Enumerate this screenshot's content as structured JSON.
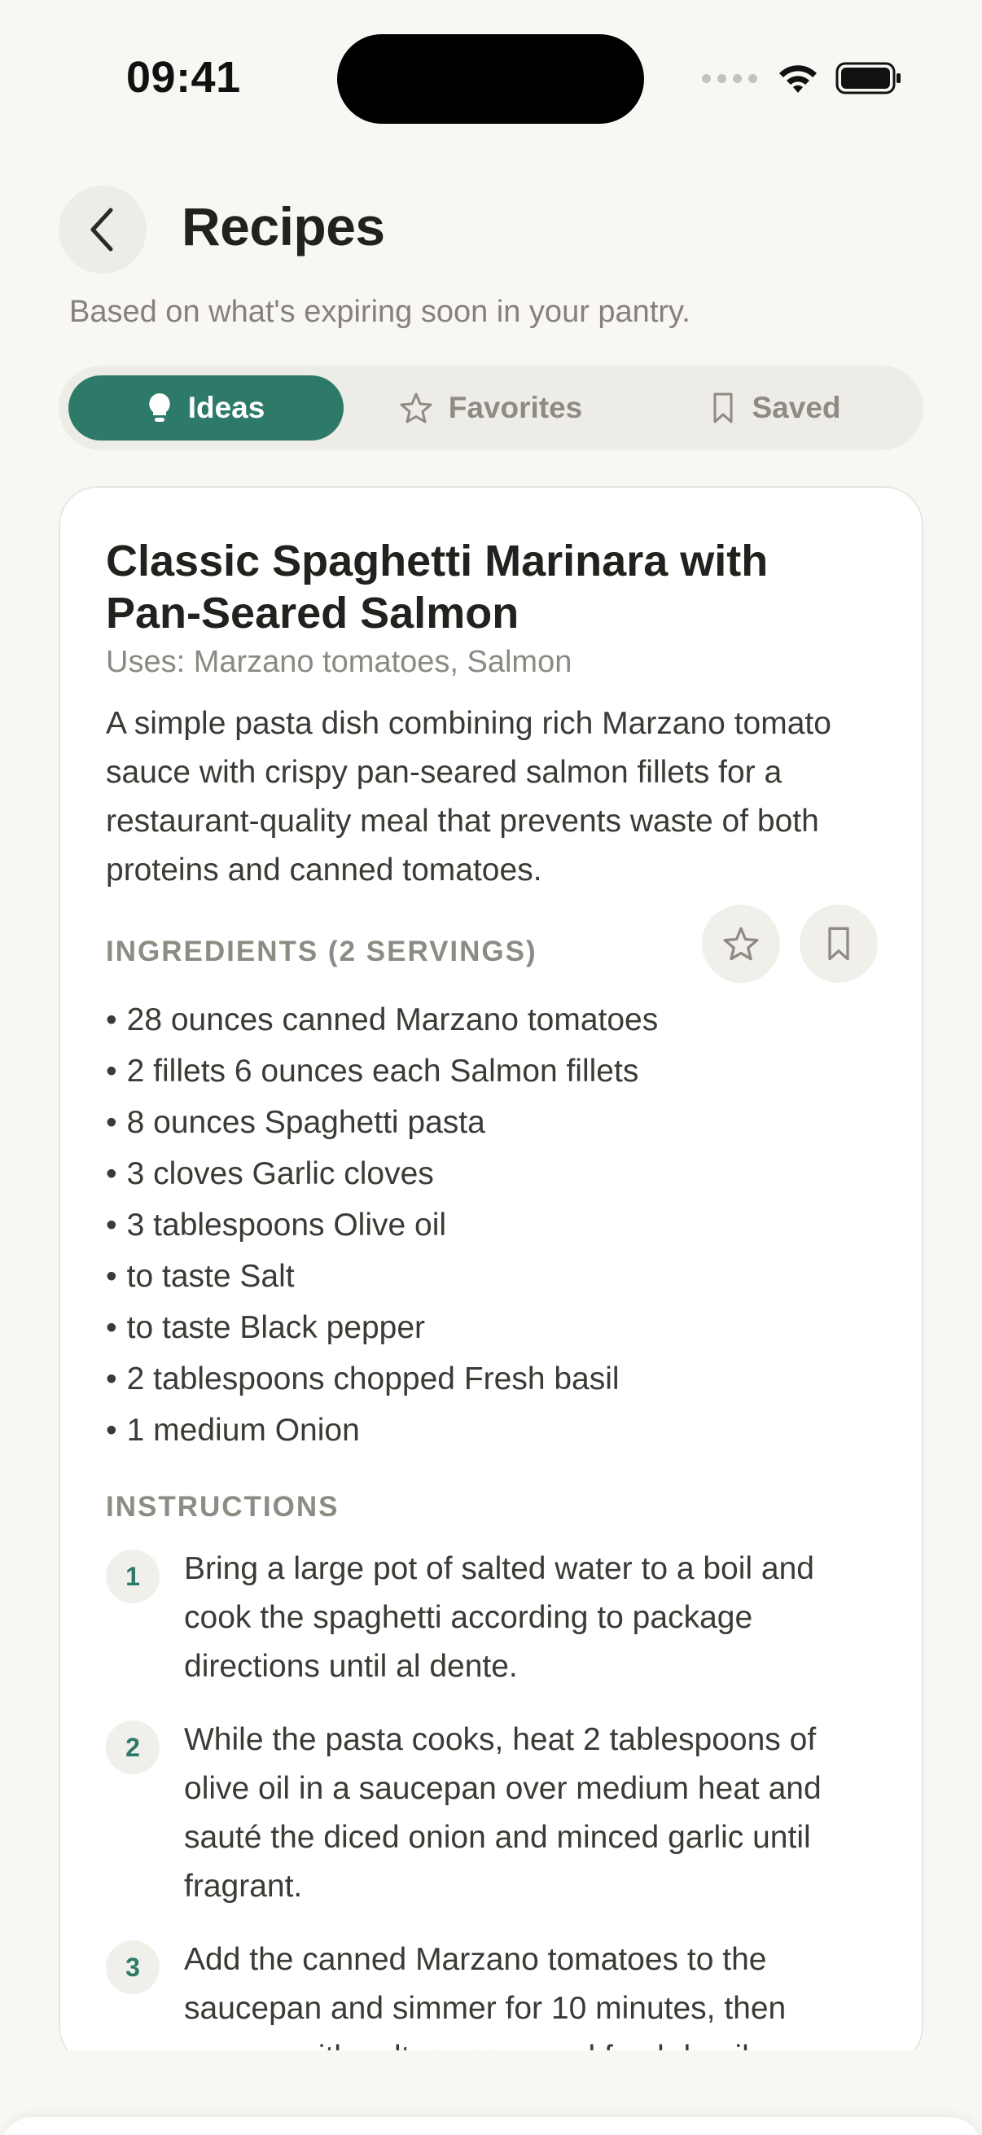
{
  "status_bar": {
    "time": "09:41"
  },
  "header": {
    "title": "Recipes",
    "subtitle": "Based on what's expiring soon in your pantry."
  },
  "tabs": [
    {
      "label": "Ideas",
      "icon": "lightbulb-icon",
      "active": true
    },
    {
      "label": "Favorites",
      "icon": "star-icon",
      "active": false
    },
    {
      "label": "Saved",
      "icon": "bookmark-icon",
      "active": false
    }
  ],
  "recipe": {
    "title": "Classic Spaghetti Marinara with Pan-Seared Salmon",
    "uses": "Uses: Marzano tomatoes, Salmon",
    "description": "A simple pasta dish combining rich Marzano tomato sauce with crispy pan-seared salmon fillets for a restaurant-quality meal that prevents waste of both proteins and canned tomatoes.",
    "ingredients_heading": "INGREDIENTS (2 SERVINGS)",
    "ingredients": [
      "28 ounces canned Marzano tomatoes",
      "2 fillets 6 ounces each Salmon fillets",
      "8 ounces Spaghetti pasta",
      "3 cloves Garlic cloves",
      "3 tablespoons Olive oil",
      "to taste Salt",
      "to taste Black pepper",
      "2 tablespoons chopped Fresh basil",
      "1 medium Onion"
    ],
    "instructions_heading": "INSTRUCTIONS",
    "instructions": [
      {
        "number": "1",
        "text": "Bring a large pot of salted water to a boil and cook the spaghetti according to package directions until al dente."
      },
      {
        "number": "2",
        "text": "While the pasta cooks, heat 2 tablespoons of olive oil in a saucepan over medium heat and sauté the diced onion and minced garlic until fragrant."
      },
      {
        "number": "3",
        "text": "Add the canned Marzano tomatoes to the saucepan and simmer for 10 minutes, then season with salt, pepper, and fresh basil."
      }
    ]
  },
  "colors": {
    "accent": "#2e7a69",
    "background": "#f8f7f3",
    "card": "#ffffff",
    "muted_text": "#8e8b84"
  }
}
